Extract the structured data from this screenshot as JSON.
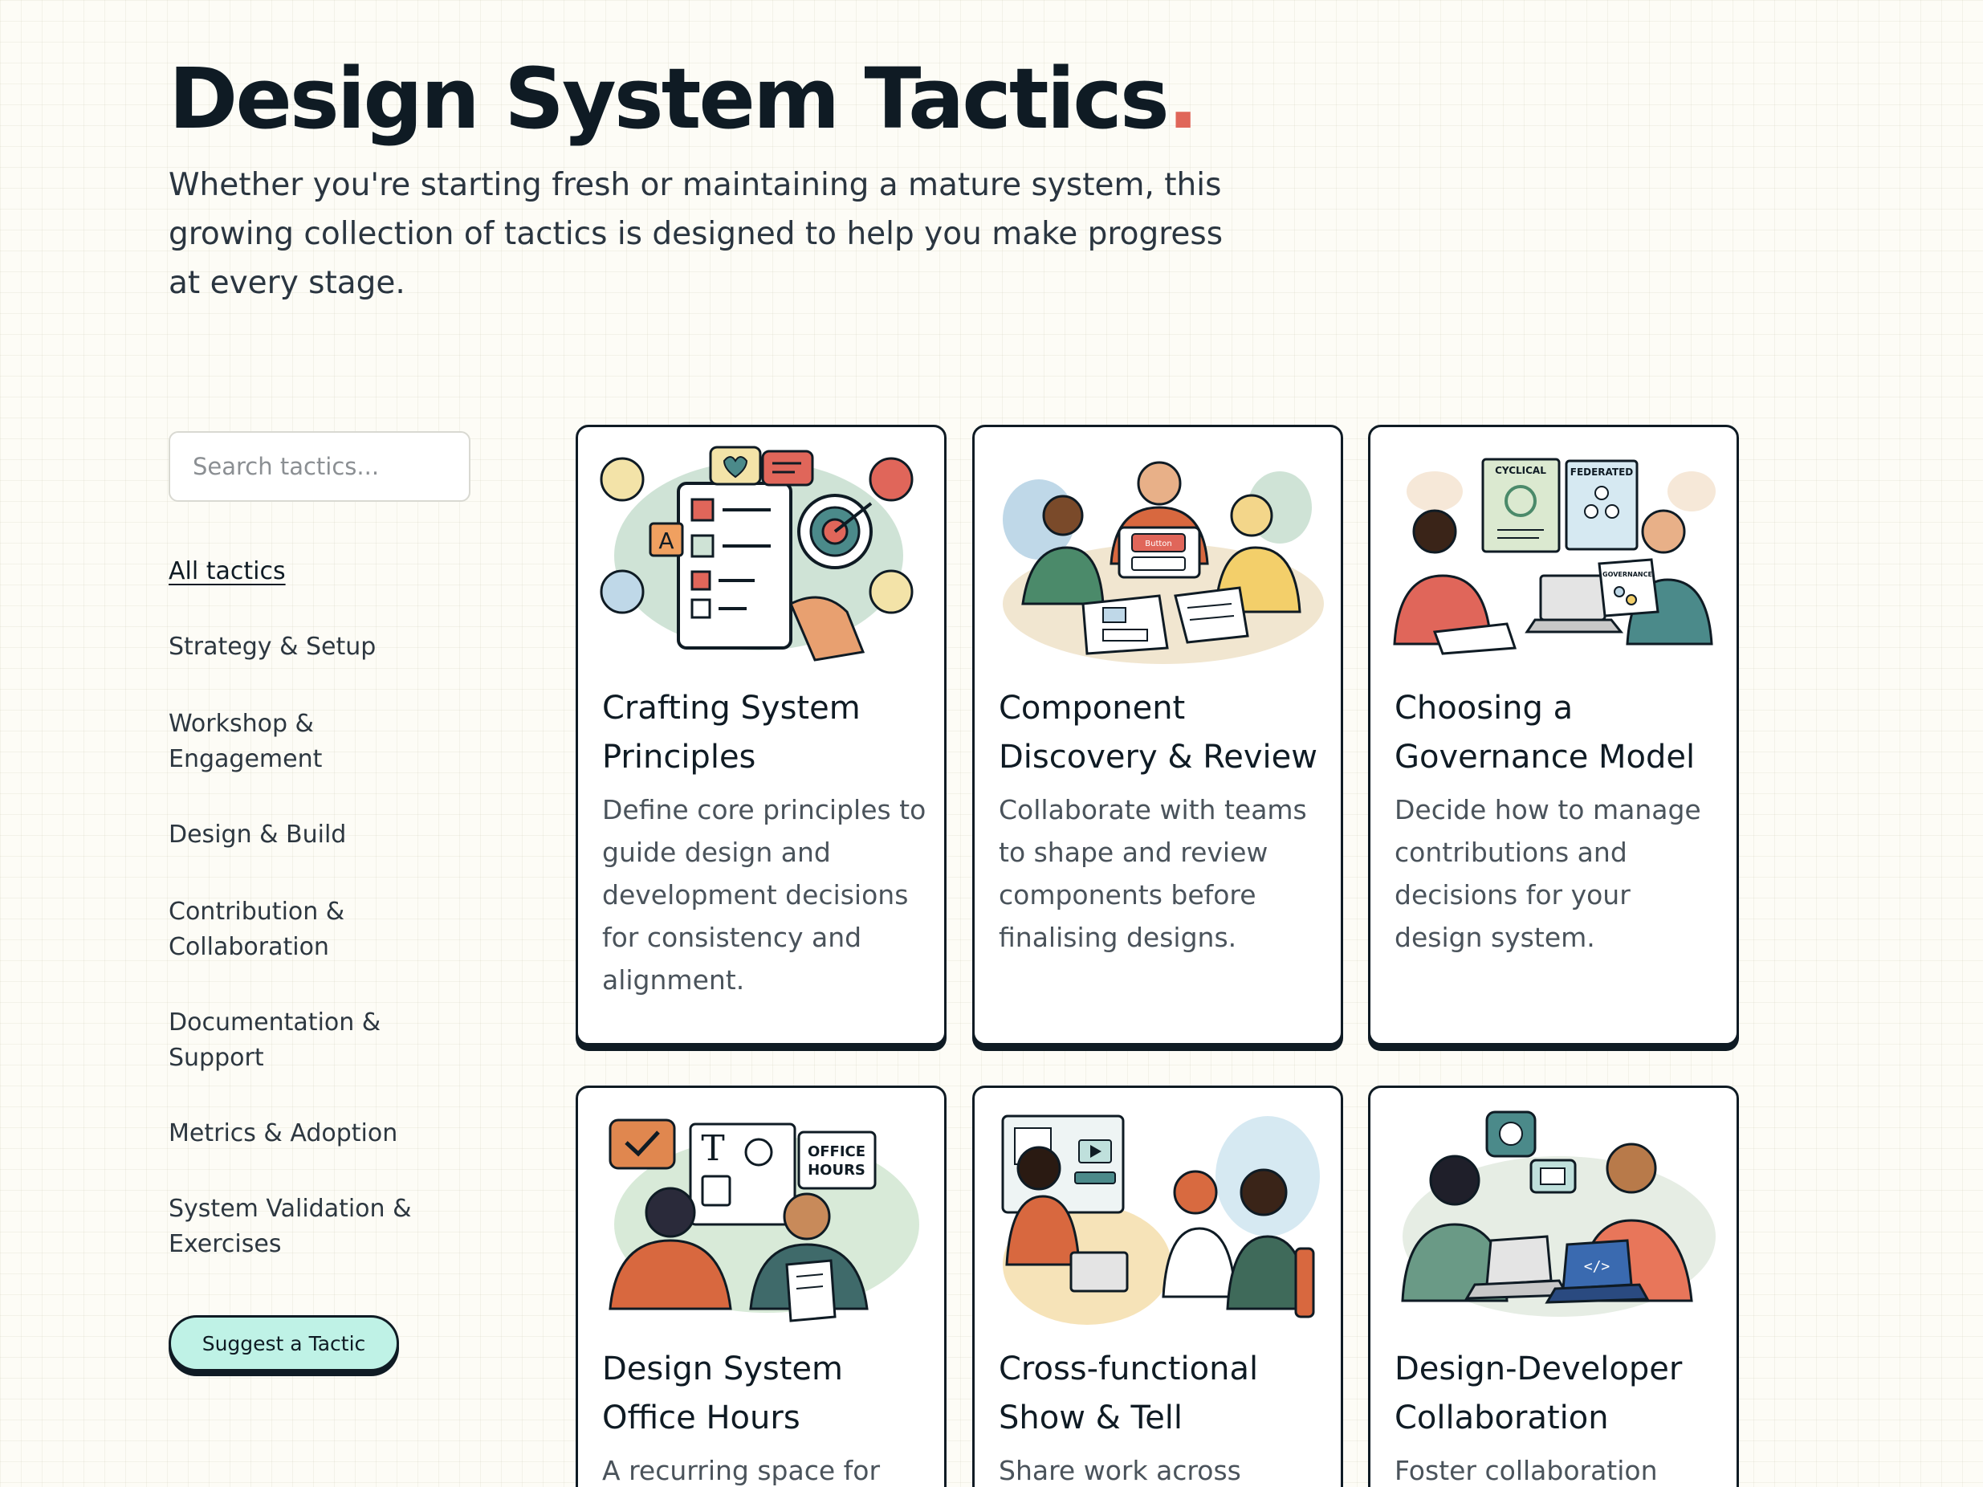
{
  "header": {
    "title": "Design System Tactics",
    "title_dot": ".",
    "intro": "Whether you're starting fresh or maintaining a mature system, this growing collection of tactics is designed to help you make progress at every stage."
  },
  "sidebar": {
    "search_placeholder": "Search tactics...",
    "items": [
      {
        "label": "All tactics",
        "active": true
      },
      {
        "label": "Strategy & Setup"
      },
      {
        "label": "Workshop & Engagement"
      },
      {
        "label": "Design & Build"
      },
      {
        "label": "Contribution & Collaboration"
      },
      {
        "label": "Documentation & Support"
      },
      {
        "label": "Metrics & Adoption"
      },
      {
        "label": "System Validation & Exercises"
      }
    ],
    "suggest_label": "Suggest a Tactic"
  },
  "cards": [
    {
      "title": "Crafting System Principles",
      "description": "Define core principles to guide design and development decisions for consistency and alignment."
    },
    {
      "title": "Component Discovery & Review",
      "description": "Collaborate with teams to shape and review components before finalising designs.",
      "illus_label": "Button"
    },
    {
      "title": "Choosing a Governance Model",
      "description": "Decide how to manage contributions and decisions for your design system.",
      "illus_labels": [
        "CYCLICAL",
        "FEDERATED",
        "GOVERNANCE"
      ]
    },
    {
      "title": "Design System Office Hours",
      "description": "A recurring space for",
      "illus_labels": [
        "OFFICE",
        "HOURS"
      ]
    },
    {
      "title": "Cross-functional Show & Tell",
      "description": "Share work across"
    },
    {
      "title": "Design-Developer Collaboration",
      "description": "Foster collaboration"
    }
  ],
  "colors": {
    "ink": "#0f1b24",
    "accent": "#e0665a",
    "suggest_bg": "#bff2e6",
    "page_bg": "#fdfcf6"
  }
}
